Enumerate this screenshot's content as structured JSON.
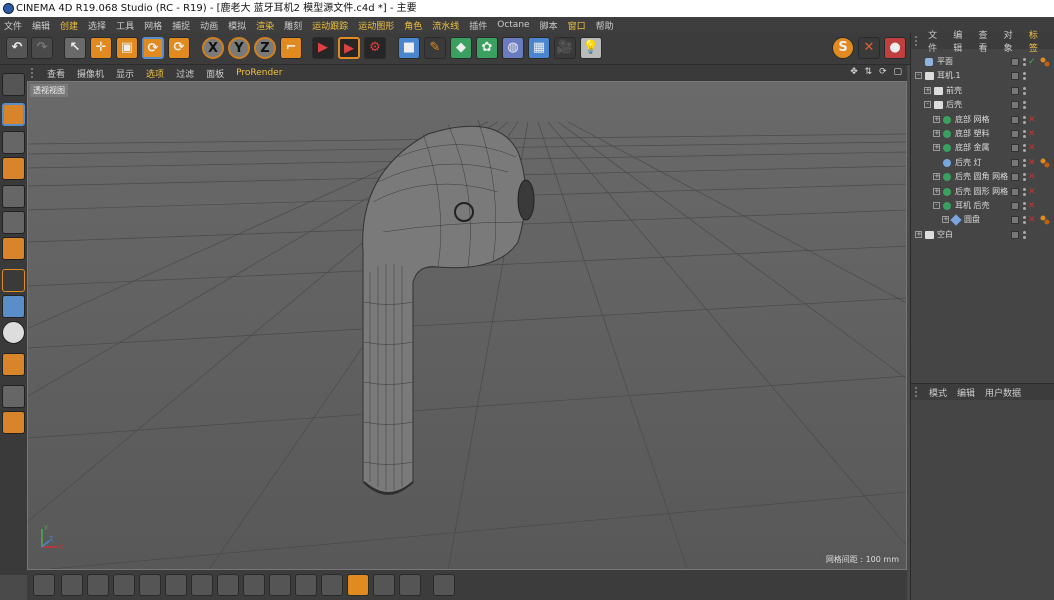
{
  "window": {
    "title": "CINEMA 4D R19.068 Studio (RC - R19) - [鹿老大 蓝牙耳机2 模型源文件.c4d *] - 主要"
  },
  "menu": {
    "items": [
      "文件",
      "编辑",
      "创建",
      "选择",
      "工具",
      "网格",
      "捕捉",
      "动画",
      "模拟",
      "渲染",
      "雕刻",
      "运动跟踪",
      "运动图形",
      "角色",
      "流水线",
      "插件",
      "Octane",
      "脚本",
      "窗口",
      "帮助"
    ]
  },
  "toolbar": {
    "x_label": "X",
    "y_label": "Y",
    "z_label": "Z",
    "s_label": "S"
  },
  "viewport_menu": {
    "items": [
      "查看",
      "摄像机",
      "显示",
      "选项",
      "过滤",
      "面板"
    ],
    "prorender": "ProRender",
    "nav_icons": "✥ ⇅ ⟳ ▢"
  },
  "viewport": {
    "label": "透视视图",
    "grid_spacing": "网格间距 : 100 mm",
    "axis_y": "Y",
    "axis_z": "Z",
    "axis_x": "X"
  },
  "object_tabs": {
    "items": [
      "文件",
      "编辑",
      "查看",
      "对象",
      "标签"
    ]
  },
  "objects": [
    {
      "name": "平面",
      "indent": 0,
      "icon": "plane",
      "check": true,
      "tree": ""
    },
    {
      "name": "耳机.1",
      "indent": 0,
      "icon": "layer",
      "check": false,
      "tree": "-"
    },
    {
      "name": "前壳",
      "indent": 1,
      "icon": "layer",
      "check": false,
      "tree": "+"
    },
    {
      "name": "后壳",
      "indent": 1,
      "icon": "layer",
      "check": false,
      "tree": "-"
    },
    {
      "name": "底部 网格",
      "indent": 2,
      "icon": "green",
      "check": false,
      "tree": "+"
    },
    {
      "name": "底部 塑料",
      "indent": 2,
      "icon": "green",
      "check": false,
      "tree": "+"
    },
    {
      "name": "底部 金属",
      "indent": 2,
      "icon": "green",
      "check": false,
      "tree": "+"
    },
    {
      "name": "后壳 灯",
      "indent": 2,
      "icon": "blue",
      "check": false,
      "tree": ""
    },
    {
      "name": "后壳 圆角 网格",
      "indent": 2,
      "icon": "green",
      "check": false,
      "tree": "+"
    },
    {
      "name": "后壳 圆形 网格",
      "indent": 2,
      "icon": "green",
      "check": false,
      "tree": "+"
    },
    {
      "name": "耳机 后壳",
      "indent": 2,
      "icon": "green",
      "check": false,
      "tree": "-"
    },
    {
      "name": "圆盘",
      "indent": 3,
      "icon": "disc",
      "check": false,
      "tree": "+"
    },
    {
      "name": "空白",
      "indent": 0,
      "icon": "layer",
      "check": false,
      "tree": "+"
    }
  ],
  "attr_tabs": {
    "items": [
      "模式",
      "编辑",
      "用户数据"
    ]
  },
  "colors": {
    "accent": "#f0c040",
    "viewport_bg": "#5e5e5e",
    "panel_bg": "#454545"
  }
}
